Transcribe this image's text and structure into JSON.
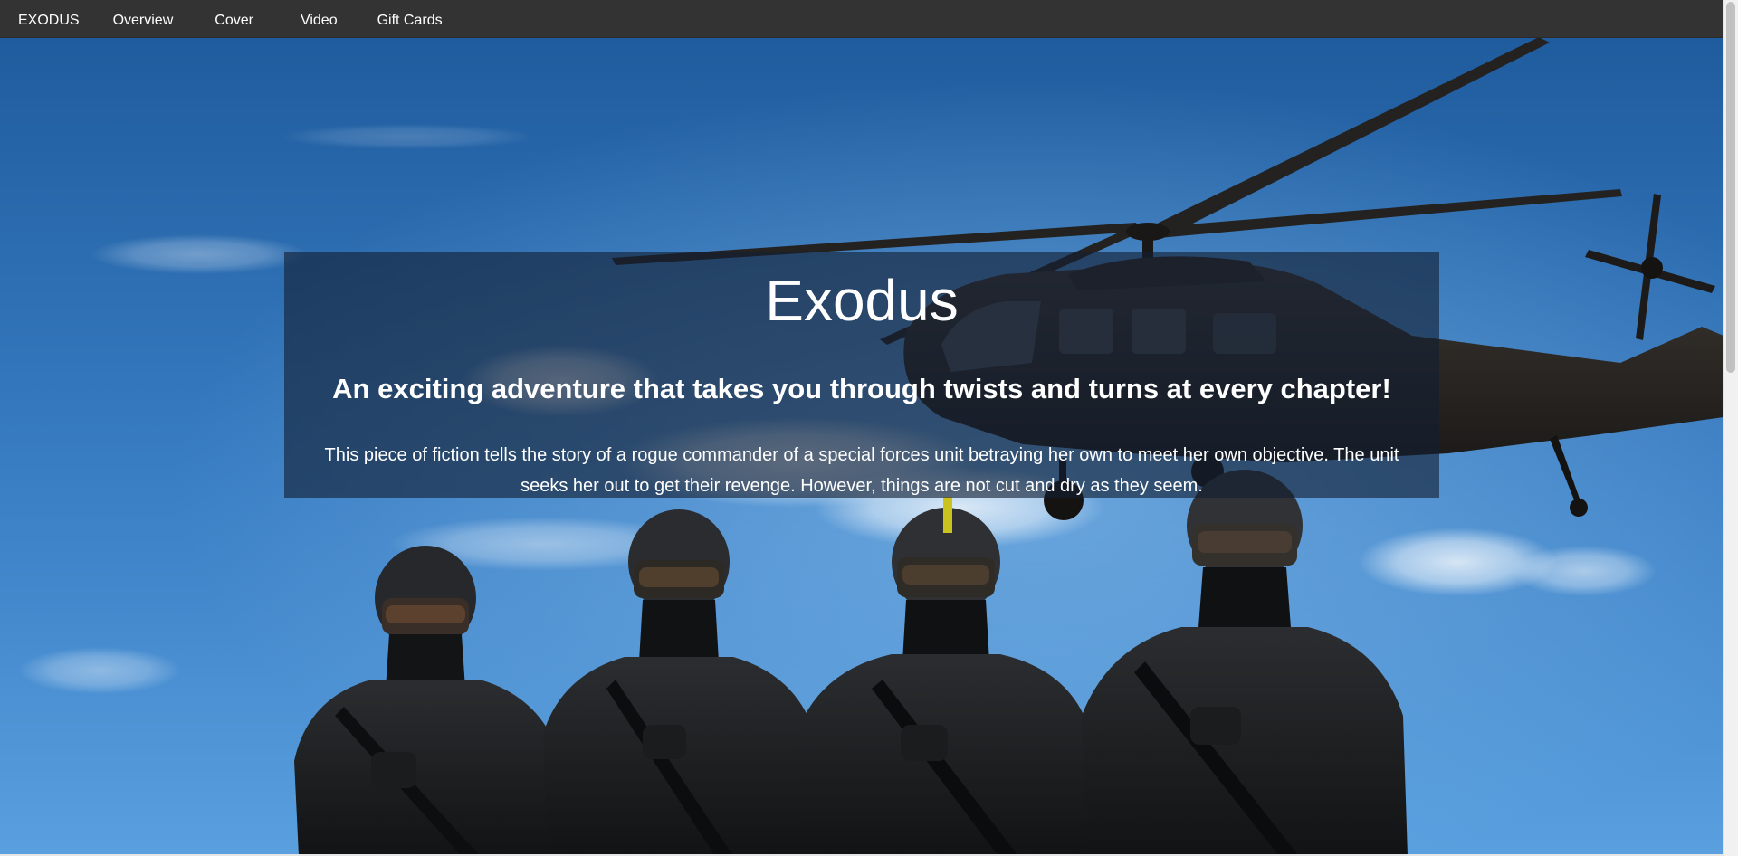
{
  "nav": {
    "brand": "EXODUS",
    "items": [
      "Overview",
      "Cover",
      "Video",
      "Gift Cards"
    ]
  },
  "hero": {
    "title": "Exodus",
    "tagline": "An exciting adventure that takes you through twists and turns at every chapter!",
    "description": "This piece of fiction tells the story of a rogue commander of a special forces unit betraying her own to meet her own objective. The unit seeks her out to get their revenge. However, things are not cut and dry as they seem."
  },
  "colors": {
    "navbar": "#333333",
    "sky_top": "#1f5c9e",
    "sky_bottom": "#4d93d6",
    "overlay": "rgba(20,30,50,0.62)"
  }
}
